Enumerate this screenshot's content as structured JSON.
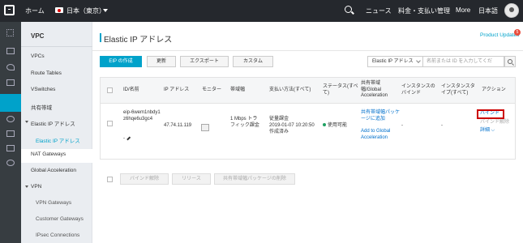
{
  "topbar": {
    "home": "ホーム",
    "region": "日本（東京）",
    "news": "ニュース",
    "billing": "料金・支払い管理",
    "more": "More",
    "language": "日本語"
  },
  "sidebar": {
    "title": "VPC",
    "items": [
      {
        "label": "VPCs"
      },
      {
        "label": "Route Tables"
      },
      {
        "label": "VSwitches"
      },
      {
        "label": "共有帯域"
      },
      {
        "label": "Elastic IP アドレス"
      },
      {
        "label": "Elastic IP アドレス"
      },
      {
        "label": "NAT Gateways"
      },
      {
        "label": "Global Acceleration"
      },
      {
        "label": "VPN"
      },
      {
        "label": "VPN Gateways"
      },
      {
        "label": "Customer Gateways"
      },
      {
        "label": "IPsec Connections"
      }
    ]
  },
  "header": {
    "title": "Elastic IP アドレス",
    "product_updates": "Product Updates",
    "badge": "5"
  },
  "toolbar": {
    "create": "EIP の作成",
    "refresh": "更新",
    "export": "エクスポート",
    "custom": "カスタム",
    "filter_select": "Elastic IP アドレス",
    "search_placeholder": "名前または ID を入力してくだ"
  },
  "table": {
    "headers": {
      "id": "ID/名前",
      "ip": "IP アドレス",
      "monitor": "モニター",
      "bandwidth": "帯域幅",
      "billing": "支払い方法(すべて)",
      "status": "ステータス(すべて)",
      "shared": "共有帯域幅/Global Acceleration",
      "instance_id": "インスタンスのバインド",
      "instance_type": "インスタンスタイプ(すべて)",
      "action": "アクション"
    },
    "row": {
      "id": "eip-6wem1nbdy1z6hqe6u3gc4",
      "id_suffix": "-",
      "ip": "47.74.11.119",
      "bandwidth": "1 Mbps トラフィック課金",
      "billing_method": "従量課金",
      "billing_time": "2019-01-07 10:20:50 作成済み",
      "status": "使用可能",
      "shared_add": "共有帯域幅パッケージに追加",
      "global_add": "Add to Global Acceleration",
      "instance": "-",
      "instance_type": "-",
      "action_bind": "バインド",
      "action_unbind": "バインド解除",
      "action_more": "詳細"
    }
  },
  "bulk": {
    "unbind": "バインド解除",
    "release": "リリース",
    "remove_shared": "共有帯域幅パッケージの削除"
  }
}
